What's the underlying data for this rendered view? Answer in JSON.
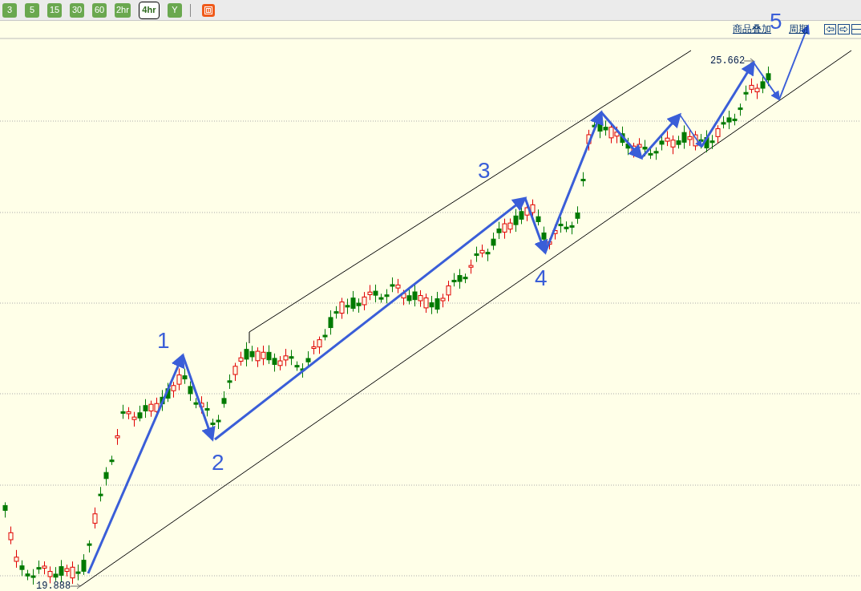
{
  "toolbar": {
    "periods": [
      {
        "label": "3",
        "selected": false
      },
      {
        "label": "5",
        "selected": false
      },
      {
        "label": "15",
        "selected": false
      },
      {
        "label": "30",
        "selected": false
      },
      {
        "label": "60",
        "selected": false
      },
      {
        "label": "2hr",
        "selected": false
      },
      {
        "label": "4hr",
        "selected": true
      },
      {
        "label": "Y",
        "selected": false
      }
    ]
  },
  "chart": {
    "links": [
      "商品叠加",
      "周期"
    ],
    "high_label": "25.662",
    "low_label": "19.888",
    "wave_labels": [
      "1",
      "2",
      "3",
      "4",
      "5"
    ]
  }
}
